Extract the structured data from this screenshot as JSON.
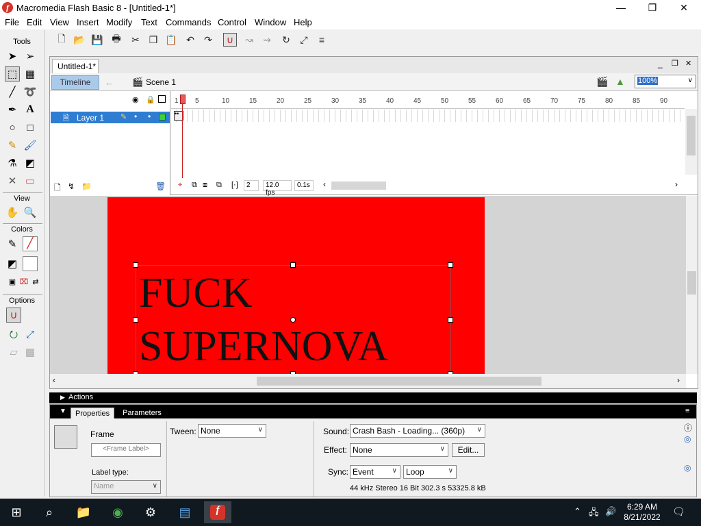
{
  "window": {
    "title": "Macromedia Flash Basic 8 - [Untitled-1*]",
    "app_icon": "flash-icon",
    "minimize": "—",
    "restore": "❐",
    "close": "✕"
  },
  "menu": [
    "File",
    "Edit",
    "View",
    "Insert",
    "Modify",
    "Text",
    "Commands",
    "Control",
    "Window",
    "Help"
  ],
  "tools_panel": {
    "tools_title": "Tools",
    "view_title": "View",
    "colors_title": "Colors",
    "options_title": "Options"
  },
  "document": {
    "tab_label": "Untitled-1*",
    "timeline_button": "Timeline",
    "scene_label": "Scene 1",
    "zoom_value": "100%",
    "window_min": "_",
    "window_restore": "❐",
    "window_close": "✕"
  },
  "timeline": {
    "layer_name": "Layer 1",
    "ruler_first": "1",
    "ruler_numbers": [
      "5",
      "10",
      "15",
      "20",
      "25",
      "30",
      "35",
      "40",
      "45",
      "50",
      "55",
      "60",
      "65",
      "70",
      "75",
      "80",
      "85",
      "90"
    ],
    "current_frame": "2",
    "frame_rate": "12.0 fps",
    "elapsed_time": "0.1s"
  },
  "stage": {
    "text": "FUCK\nSUPERNOVA",
    "background_color": "#ff0000"
  },
  "actions_panel": {
    "label": "Actions"
  },
  "properties": {
    "tab_properties": "Properties",
    "tab_parameters": "Parameters",
    "frame_label": "Frame",
    "frame_label_placeholder": "<Frame Label>",
    "tween_label": "Tween:",
    "tween_value": "None",
    "label_type_label": "Label type:",
    "label_type_value": "Name",
    "sound_label": "Sound:",
    "sound_value": "Crash Bash - Loading... (360p)",
    "effect_label": "Effect:",
    "effect_value": "None",
    "edit_button": "Edit...",
    "sync_label": "Sync:",
    "sync_value": "Event",
    "repeat_value": "Loop",
    "sound_info": "44 kHz Stereo 16 Bit 302.3 s 53325.8 kB"
  },
  "taskbar": {
    "time": "6:29 AM",
    "date": "8/21/2022"
  }
}
